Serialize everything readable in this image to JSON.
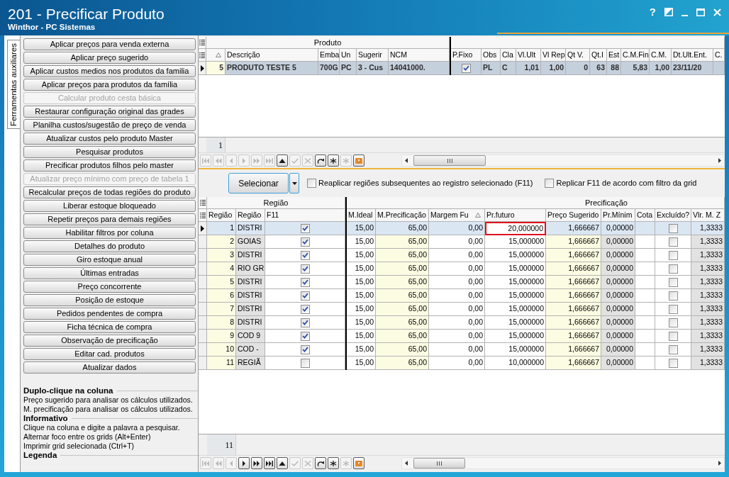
{
  "window": {
    "title": "201 - Precificar Produto",
    "subtitle": "Winthor - PC Sistemas",
    "help_button": "?"
  },
  "side_tab": {
    "label": "Ferramentas auxiliares",
    "selected": true
  },
  "actions": [
    {
      "label": "Aplicar preços para venda externa",
      "disabled": false
    },
    {
      "label": "Aplicar preço sugerido",
      "disabled": false
    },
    {
      "label": "Aplicar custos medios nos produtos da familia",
      "disabled": false
    },
    {
      "label": "Aplicar preços para produtos da família",
      "disabled": false
    },
    {
      "label": "Calcular produto cesta básica",
      "disabled": true
    },
    {
      "label": "Restaurar configuração original das grades",
      "disabled": false
    },
    {
      "label": "Planilha custos/sugestão de preço de venda",
      "disabled": false
    },
    {
      "label": "Atualizar custos pelo produto Master",
      "disabled": false
    },
    {
      "label": "Pesquisar produtos",
      "disabled": false
    },
    {
      "label": "Precificar produtos filhos pelo master",
      "disabled": false
    },
    {
      "label": "Atualizar preço mínimo com preço de tabela 1",
      "disabled": true
    },
    {
      "label": "Recalcular preços de todas regiões do produto",
      "disabled": false
    },
    {
      "label": "Liberar estoque bloqueado",
      "disabled": false
    },
    {
      "label": "Repetir preços para demais regiões",
      "disabled": false
    },
    {
      "label": "Habilitar filtros por coluna",
      "disabled": false
    },
    {
      "label": "Detalhes do produto",
      "disabled": false
    },
    {
      "label": "Giro estoque anual",
      "disabled": false
    },
    {
      "label": "Últimas entradas",
      "disabled": false
    },
    {
      "label": "Preço concorrente",
      "disabled": false
    },
    {
      "label": "Posição de estoque",
      "disabled": false
    },
    {
      "label": "Pedidos pendentes de compra",
      "disabled": false
    },
    {
      "label": "Ficha técnica de compra",
      "disabled": false
    },
    {
      "label": "Observação de precificação",
      "disabled": false
    },
    {
      "label": "Editar cad. produtos",
      "disabled": false
    },
    {
      "label": "Atualizar dados",
      "disabled": false
    }
  ],
  "info": [
    {
      "heading": "Duplo-clique na coluna",
      "lines": [
        "Preço sugerido para analisar os cálculos utilizados.",
        "M. precificação para analisar os cálculos utilizados."
      ]
    },
    {
      "heading": "Informativo",
      "lines": [
        "Clique na coluna e digite a palavra a pesquisar.",
        "Alternar foco entre os grids (Alt+Enter)",
        "Imprimir grid selecionada (Ctrl+T)"
      ]
    },
    {
      "heading": "Legenda"
    }
  ],
  "product_grid": {
    "groups": [
      "Produto"
    ],
    "columns": [
      {
        "kind": "text",
        "sorted": true
      },
      {
        "label": "Descrição",
        "kind": "text",
        "sorted": false
      },
      {
        "label": "Emba",
        "kind": "text",
        "sorted": false
      },
      {
        "label": "Un",
        "kind": "text",
        "sorted": false
      },
      {
        "label": "Sugerir",
        "kind": "text",
        "sorted": false
      },
      {
        "label": "NCM",
        "kind": "text",
        "sorted": false
      },
      {
        "label": "P.Fixo",
        "kind": "check",
        "sorted": false
      },
      {
        "label": "Obs",
        "kind": "text",
        "sorted": false
      },
      {
        "label": "Cla",
        "kind": "text",
        "sorted": false
      },
      {
        "label": "Vl.Ult",
        "kind": "text",
        "sorted": false
      },
      {
        "label": "Vl Rep",
        "kind": "text",
        "sorted": false
      },
      {
        "label": "Qt V.",
        "kind": "text",
        "sorted": false
      },
      {
        "label": "Qt.I",
        "kind": "text",
        "sorted": false
      },
      {
        "label": "Est",
        "kind": "text",
        "sorted": false
      },
      {
        "label": "C.M.Fin",
        "kind": "text",
        "sorted": false
      },
      {
        "label": "C.M.",
        "kind": "text",
        "sorted": false
      },
      {
        "label": "Dt.Ult.Ent.",
        "kind": "text",
        "sorted": false
      },
      {
        "label": "C.",
        "kind": "text",
        "sorted": false
      }
    ],
    "rows": [
      {
        "selected": true,
        "cells": [
          "5",
          "PRODUTO TESTE 5",
          "700G",
          "PC",
          "3 - Cus",
          "14041000.",
          true,
          "PL",
          "C",
          "1,01",
          "1,00",
          "0",
          "63",
          "88",
          "5,83",
          "1,00",
          "23/11/20"
        ]
      }
    ],
    "count": "1",
    "navigator": [
      {
        "kind": "first",
        "disabled": true
      },
      {
        "kind": "prev_page",
        "disabled": true
      },
      {
        "kind": "prev",
        "disabled": true
      },
      {
        "kind": "next",
        "disabled": true
      },
      {
        "kind": "next_page",
        "disabled": true
      },
      {
        "kind": "last",
        "disabled": true
      },
      {
        "kind": "up",
        "disabled": false
      },
      {
        "kind": "confirm",
        "disabled": true
      },
      {
        "kind": "cancel",
        "disabled": true
      },
      {
        "kind": "refresh",
        "disabled": false
      },
      {
        "kind": "asterisk",
        "disabled": false
      },
      {
        "kind": "asterisk",
        "disabled": true
      },
      {
        "kind": "filter",
        "disabled": false
      }
    ]
  },
  "options": {
    "select_button": "Selecionar",
    "checkboxes": [
      {
        "label": "Reaplicar regiões subsequentes ao registro selecionado (F11)",
        "checked": false
      },
      {
        "label": "Replicar F11 de acordo com filtro da grid",
        "checked": false
      }
    ]
  },
  "region_grid": {
    "groups": [
      "Região",
      "Precificação"
    ],
    "columns": [
      {
        "label": "Região",
        "kind": "text",
        "sorted": false
      },
      {
        "label": "Região",
        "kind": "text",
        "sorted": false
      },
      {
        "label": "F11",
        "kind": "check",
        "sorted": false
      },
      {
        "label": "M.Ideal",
        "kind": "text",
        "sorted": false
      },
      {
        "label": "M.Precificação",
        "kind": "text",
        "sorted": false
      },
      {
        "label": "Margem Fu",
        "kind": "text",
        "sorted": true
      },
      {
        "label": "Pr.futuro",
        "kind": "text",
        "sorted": false
      },
      {
        "label": "Preço Sugerido",
        "kind": "text",
        "sorted": false
      },
      {
        "label": "Pr.Mínim",
        "kind": "text",
        "sorted": false
      },
      {
        "label": "Cota",
        "kind": "text",
        "sorted": false
      },
      {
        "label": "Excluído?",
        "kind": "check",
        "sorted": false
      },
      {
        "label": "Vlr. M. Z",
        "kind": "text",
        "sorted": false
      }
    ],
    "rows": [
      {
        "selected": true,
        "editing": true,
        "cells": [
          "1",
          "DISTRI",
          true,
          "15,00",
          "65,00",
          "0,00",
          "20,000000",
          "1,666667",
          "0,00000",
          null,
          false,
          "1,3333"
        ]
      },
      {
        "selected": false,
        "editing": false,
        "cells": [
          "2",
          "GOIAS",
          true,
          "15,00",
          "65,00",
          "0,00",
          "15,000000",
          "1,666667",
          "0,00000",
          null,
          false,
          "1,3333"
        ]
      },
      {
        "selected": false,
        "editing": false,
        "cells": [
          "3",
          "DISTRI",
          true,
          "15,00",
          "65,00",
          "0,00",
          "15,000000",
          "1,666667",
          "0,00000",
          null,
          false,
          "1,3333"
        ]
      },
      {
        "selected": false,
        "editing": false,
        "cells": [
          "4",
          "RIO GR",
          true,
          "15,00",
          "65,00",
          "0,00",
          "15,000000",
          "1,666667",
          "0,00000",
          null,
          false,
          "1,3333"
        ]
      },
      {
        "selected": false,
        "editing": false,
        "cells": [
          "5",
          "DISTRI",
          true,
          "15,00",
          "65,00",
          "0,00",
          "15,000000",
          "1,666667",
          "0,00000",
          null,
          false,
          "1,3333"
        ]
      },
      {
        "selected": false,
        "editing": false,
        "cells": [
          "6",
          "DISTRI",
          true,
          "15,00",
          "65,00",
          "0,00",
          "15,000000",
          "1,666667",
          "0,00000",
          null,
          false,
          "1,3333"
        ]
      },
      {
        "selected": false,
        "editing": false,
        "cells": [
          "7",
          "DISTRI",
          true,
          "15,00",
          "65,00",
          "0,00",
          "15,000000",
          "1,666667",
          "0,00000",
          null,
          false,
          "1,3333"
        ]
      },
      {
        "selected": false,
        "editing": false,
        "cells": [
          "8",
          "DISTRI",
          true,
          "15,00",
          "65,00",
          "0,00",
          "15,000000",
          "1,666667",
          "0,00000",
          null,
          false,
          "1,3333"
        ]
      },
      {
        "selected": false,
        "editing": false,
        "cells": [
          "9",
          "COD 9",
          true,
          "15,00",
          "65,00",
          "0,00",
          "15,000000",
          "1,666667",
          "0,00000",
          null,
          false,
          "1,3333"
        ]
      },
      {
        "selected": false,
        "editing": false,
        "cells": [
          "10",
          "COD -",
          true,
          "15,00",
          "65,00",
          "0,00",
          "15,000000",
          "1,666667",
          "0,00000",
          null,
          false,
          "1,3333"
        ]
      },
      {
        "selected": false,
        "editing": false,
        "cells": [
          "11",
          "REGIÃ",
          false,
          "15,00",
          "65,00",
          "0,00",
          "10,000000",
          "1,666667",
          "0,00000",
          null,
          false,
          "1,3333"
        ]
      }
    ],
    "count": "11",
    "navigator": [
      {
        "kind": "first",
        "disabled": true
      },
      {
        "kind": "prev_page",
        "disabled": true
      },
      {
        "kind": "prev",
        "disabled": true
      },
      {
        "kind": "next",
        "disabled": false
      },
      {
        "kind": "next_page",
        "disabled": false
      },
      {
        "kind": "last",
        "disabled": false
      },
      {
        "kind": "up",
        "disabled": false
      },
      {
        "kind": "confirm",
        "disabled": true
      },
      {
        "kind": "cancel",
        "disabled": true
      },
      {
        "kind": "refresh",
        "disabled": false
      },
      {
        "kind": "asterisk",
        "disabled": false
      },
      {
        "kind": "asterisk",
        "disabled": true
      },
      {
        "kind": "filter",
        "disabled": false
      }
    ]
  }
}
